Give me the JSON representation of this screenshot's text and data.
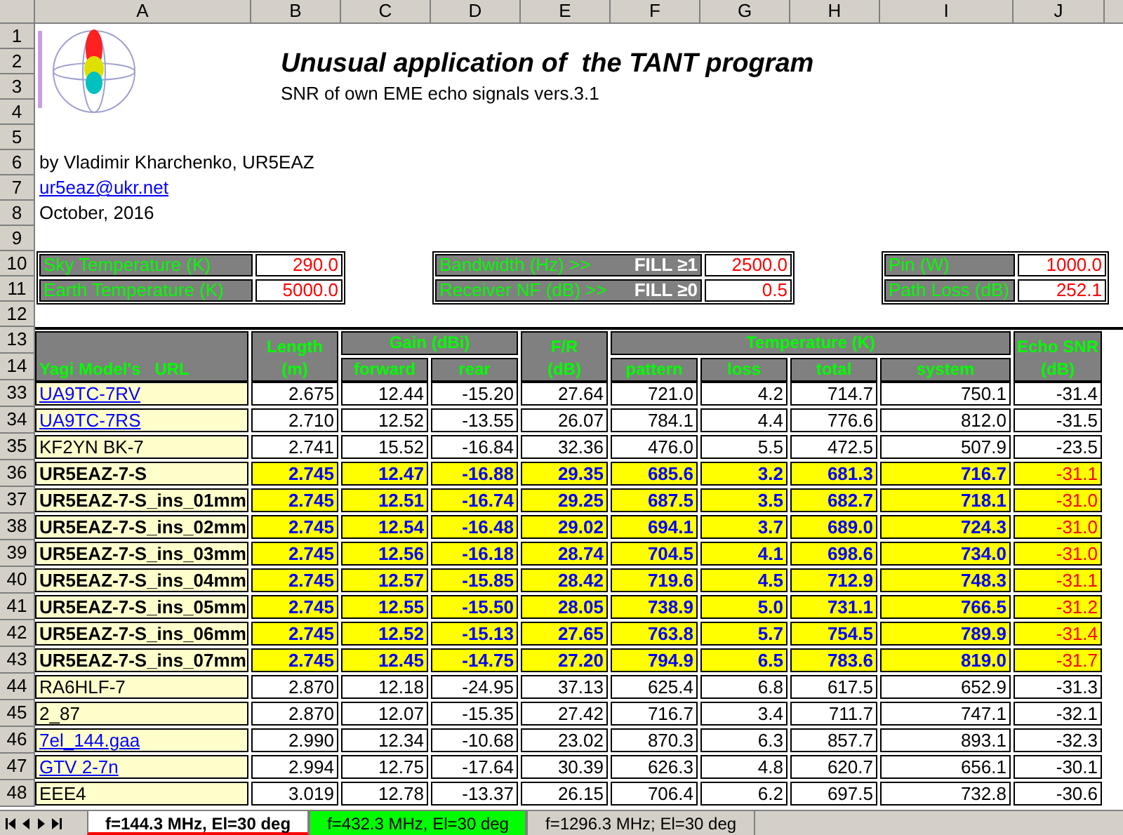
{
  "column_headers": [
    "A",
    "B",
    "C",
    "D",
    "E",
    "F",
    "G",
    "H",
    "I",
    "J"
  ],
  "top_row_numbers": [
    "1",
    "2",
    "3",
    "4",
    "5",
    "6",
    "7",
    "8",
    "9",
    "10",
    "11",
    "12",
    "13",
    "14"
  ],
  "title": "Unusual application of  the TANT program",
  "subtitle": "SNR of own EME echo signals vers.3.1",
  "author": "by Vladimir Kharchenko, UR5EAZ",
  "email": "ur5eaz@ukr.net",
  "date": "October, 2016",
  "param_blocks": [
    {
      "kind": "plain",
      "rows": [
        {
          "label": "Sky Temperature (K)",
          "value": "290.0"
        },
        {
          "label": "Earth Temperature (K)",
          "value": "5000.0"
        }
      ]
    },
    {
      "kind": "fill",
      "rows": [
        {
          "label": "Bandwidth (Hz) >>",
          "note": "FILL ≥1",
          "value": "2500.0"
        },
        {
          "label": "Receiver NF (dB) >>",
          "note": "FILL ≥0",
          "value": "0.5"
        }
      ]
    },
    {
      "kind": "plain",
      "rows": [
        {
          "label": "Pin (W)",
          "value": "1000.0"
        },
        {
          "label": "Path Loss (dB)",
          "value": "252.1"
        }
      ]
    }
  ],
  "table": {
    "model_header": "Yagi Model's   URL",
    "length_header": [
      "Length",
      "(m)"
    ],
    "gain_header": "Gain (dBi)",
    "gain_columns": [
      "forward",
      "rear"
    ],
    "fr_header": [
      "F/R",
      "(dB)"
    ],
    "temperature_header": "Temperature (K)",
    "temperature_columns": [
      "pattern",
      "loss",
      "total",
      "system"
    ],
    "snr_header": [
      "Echo SNR",
      "(dB)"
    ],
    "rows": [
      {
        "row": "33",
        "model": "UA9TC-7RV",
        "link": true,
        "highlighted": false,
        "values": [
          "2.675",
          "12.44",
          "-15.20",
          "27.64",
          "721.0",
          "4.2",
          "714.7",
          "750.1",
          "-31.4"
        ]
      },
      {
        "row": "34",
        "model": "UA9TC-7RS",
        "link": true,
        "highlighted": false,
        "values": [
          "2.710",
          "12.52",
          "-13.55",
          "26.07",
          "784.1",
          "4.4",
          "776.6",
          "812.0",
          "-31.5"
        ]
      },
      {
        "row": "35",
        "model": "KF2YN BK-7",
        "link": false,
        "highlighted": false,
        "values": [
          "2.741",
          "15.52",
          "-16.84",
          "32.36",
          "476.0",
          "5.5",
          "472.5",
          "507.9",
          "-23.5"
        ]
      },
      {
        "row": "36",
        "model": "UR5EAZ-7-S",
        "link": false,
        "highlighted": true,
        "values": [
          "2.745",
          "12.47",
          "-16.88",
          "29.35",
          "685.6",
          "3.2",
          "681.3",
          "716.7",
          "-31.1"
        ]
      },
      {
        "row": "37",
        "model": "UR5EAZ-7-S_ins_01mm",
        "link": false,
        "highlighted": true,
        "values": [
          "2.745",
          "12.51",
          "-16.74",
          "29.25",
          "687.5",
          "3.5",
          "682.7",
          "718.1",
          "-31.0"
        ]
      },
      {
        "row": "38",
        "model": "UR5EAZ-7-S_ins_02mm",
        "link": false,
        "highlighted": true,
        "values": [
          "2.745",
          "12.54",
          "-16.48",
          "29.02",
          "694.1",
          "3.7",
          "689.0",
          "724.3",
          "-31.0"
        ]
      },
      {
        "row": "39",
        "model": "UR5EAZ-7-S_ins_03mm",
        "link": false,
        "highlighted": true,
        "values": [
          "2.745",
          "12.56",
          "-16.18",
          "28.74",
          "704.5",
          "4.1",
          "698.6",
          "734.0",
          "-31.0"
        ]
      },
      {
        "row": "40",
        "model": "UR5EAZ-7-S_ins_04mm",
        "link": false,
        "highlighted": true,
        "values": [
          "2.745",
          "12.57",
          "-15.85",
          "28.42",
          "719.6",
          "4.5",
          "712.9",
          "748.3",
          "-31.1"
        ]
      },
      {
        "row": "41",
        "model": "UR5EAZ-7-S_ins_05mm",
        "link": false,
        "highlighted": true,
        "values": [
          "2.745",
          "12.55",
          "-15.50",
          "28.05",
          "738.9",
          "5.0",
          "731.1",
          "766.5",
          "-31.2"
        ]
      },
      {
        "row": "42",
        "model": "UR5EAZ-7-S_ins_06mm",
        "link": false,
        "highlighted": true,
        "values": [
          "2.745",
          "12.52",
          "-15.13",
          "27.65",
          "763.8",
          "5.7",
          "754.5",
          "789.9",
          "-31.4"
        ]
      },
      {
        "row": "43",
        "model": "UR5EAZ-7-S_ins_07mm",
        "link": false,
        "highlighted": true,
        "values": [
          "2.745",
          "12.45",
          "-14.75",
          "27.20",
          "794.9",
          "6.5",
          "783.6",
          "819.0",
          "-31.7"
        ]
      },
      {
        "row": "44",
        "model": "RA6HLF-7",
        "link": false,
        "highlighted": false,
        "values": [
          "2.870",
          "12.18",
          "-24.95",
          "37.13",
          "625.4",
          "6.8",
          "617.5",
          "652.9",
          "-31.3"
        ]
      },
      {
        "row": "45",
        "model": "2_87",
        "link": false,
        "highlighted": false,
        "values": [
          "2.870",
          "12.07",
          "-15.35",
          "27.42",
          "716.7",
          "3.4",
          "711.7",
          "747.1",
          "-32.1"
        ]
      },
      {
        "row": "46",
        "model": "7el_144.gaa",
        "link": true,
        "highlighted": false,
        "values": [
          "2.990",
          "12.34",
          "-10.68",
          "23.02",
          "870.3",
          "6.3",
          "857.7",
          "893.1",
          "-32.3"
        ]
      },
      {
        "row": "47",
        "model": "GTV 2-7n",
        "link": true,
        "highlighted": false,
        "values": [
          "2.994",
          "12.75",
          "-17.64",
          "30.39",
          "626.3",
          "4.8",
          "620.7",
          "656.1",
          "-30.1"
        ]
      },
      {
        "row": "48",
        "model": "EEE4",
        "link": false,
        "highlighted": false,
        "values": [
          "3.019",
          "12.78",
          "-13.37",
          "26.15",
          "706.4",
          "6.2",
          "697.5",
          "732.8",
          "-30.6"
        ]
      }
    ]
  },
  "sheet_tabs": [
    {
      "label": "f=144.3 MHz, El=30 deg",
      "selected": true,
      "color": "#ff0000"
    },
    {
      "label": "f=432.3 MHz, El=30 deg",
      "selected": false,
      "color": "#00ff00"
    },
    {
      "label": "f=1296.3 MHz; El=30 deg",
      "selected": false,
      "color": "#d4d0c8"
    }
  ]
}
